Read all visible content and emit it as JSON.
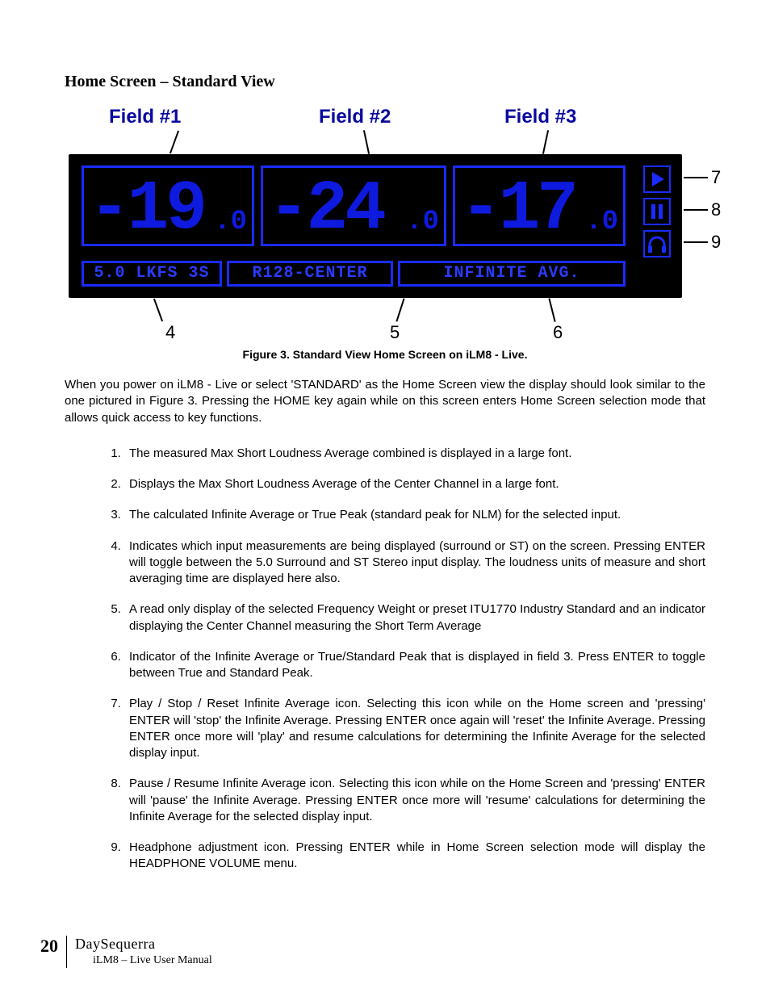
{
  "heading": "Home Screen – Standard View",
  "figure": {
    "field_labels": [
      "Field #1",
      "Field #2",
      "Field #3"
    ],
    "values": {
      "f1_main": "-19",
      "f1_dec": ".0",
      "f2_main": "-24",
      "f2_dec": ".0",
      "f3_main": "-17",
      "f3_dec": ".0"
    },
    "info": {
      "box4": "5.0 LKFS 3S",
      "box5": "R128-CENTER",
      "box6": "INFINITE  AVG."
    },
    "callouts": {
      "c4": "4",
      "c5": "5",
      "c6": "6",
      "c7": "7",
      "c8": "8",
      "c9": "9"
    },
    "caption": "Figure 3.    Standard View Home Screen on iLM8 - Live."
  },
  "intro": "When you power on iLM8 - Live or select 'STANDARD' as the Home Screen view the display should look similar to the one pictured in Figure 3.  Pressing the HOME key again while on this screen enters Home Screen selection mode that allows quick access to key functions.",
  "list": [
    "The measured Max Short Loudness Average combined is displayed in a large font.",
    "Displays the Max Short Loudness Average of the Center Channel in a large font.",
    "The calculated Infinite Average or True Peak (standard peak for NLM) for the selected input.",
    "Indicates which input measurements are being displayed (surround or ST) on the screen. Pressing ENTER will toggle between the 5.0 Surround and ST Stereo input display. The loudness units of measure and short averaging time are displayed here also.",
    "A read only display of the selected Frequency Weight or preset ITU1770 Industry Standard and an indicator displaying the Center Channel measuring the Short Term Average",
    "Indicator of the Infinite Average or True/Standard Peak that is displayed in field 3. Press ENTER to toggle between True and Standard Peak.",
    "Play / Stop / Reset Infinite Average icon. Selecting this icon while on the Home screen and 'pressing' ENTER will 'stop' the Infinite Average.  Pressing ENTER once again will 'reset' the Infinite Average.  Pressing ENTER once more will 'play' and resume calculations for determining the Infinite Average for the selected display input.",
    "Pause / Resume Infinite Average icon.  Selecting this icon while on the Home Screen and 'pressing' ENTER will 'pause' the Infinite Average.  Pressing ENTER once more will 'resume' calculations for determining the Infinite Average for the selected display input.",
    "Headphone adjustment icon. Pressing ENTER while in Home Screen selection mode will display the HEADPHONE VOLUME menu."
  ],
  "footer": {
    "page": "20",
    "brand": "DaySequerra",
    "manual": "iLM8 – Live User Manual"
  }
}
